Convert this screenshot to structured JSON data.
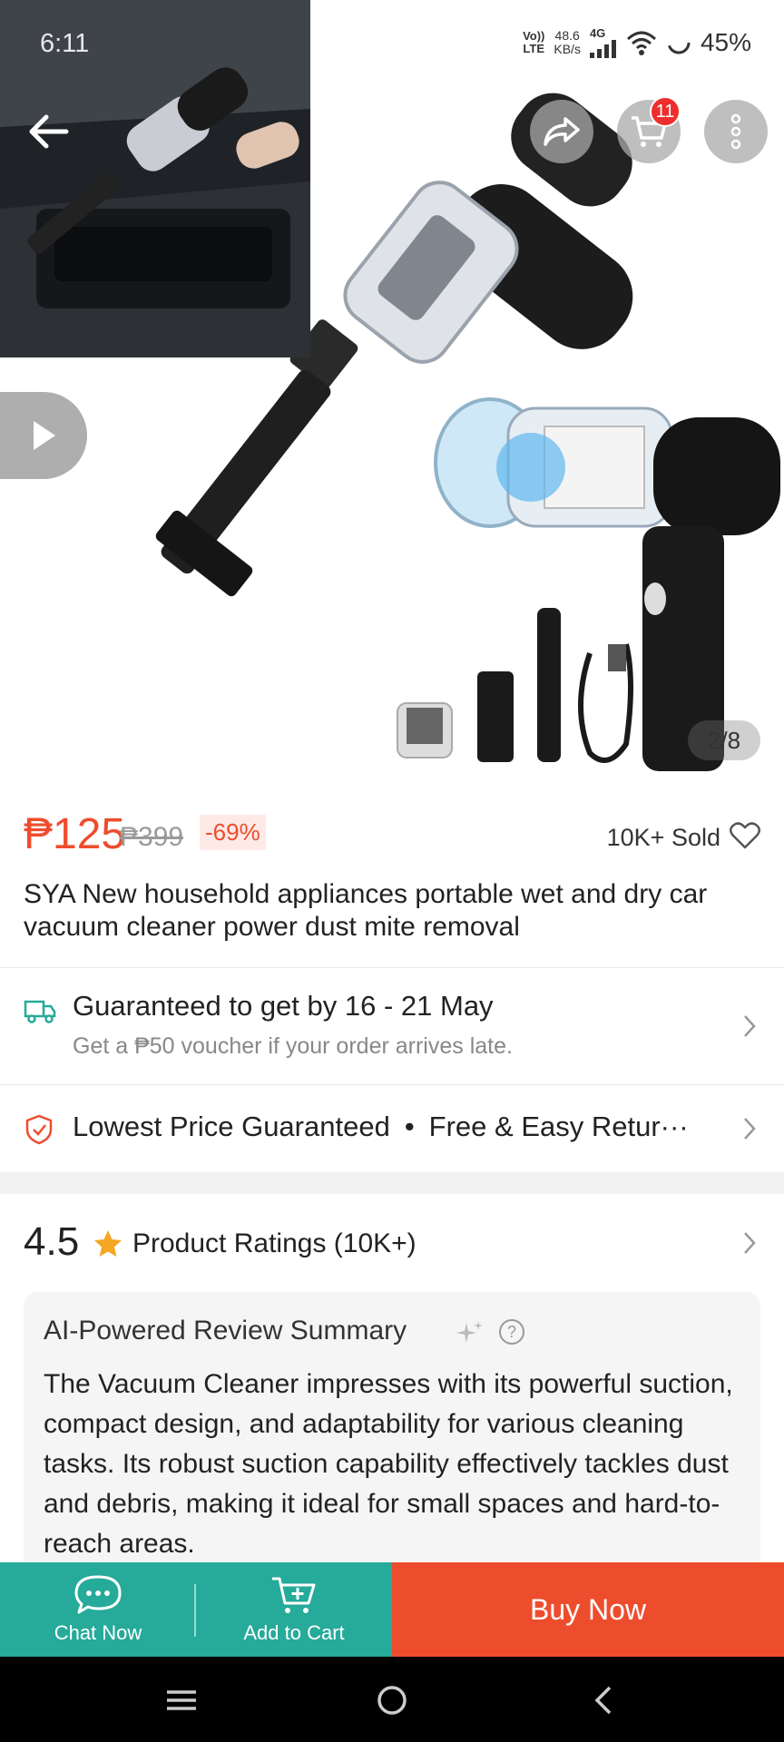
{
  "status_bar": {
    "time": "6:11",
    "network_badge_top": "Vo))",
    "network_badge_bottom": "LTE",
    "speed_value": "48.6",
    "speed_unit": "KB/s",
    "signal_type": "4G",
    "battery": "45%"
  },
  "header": {
    "cart_count": "11"
  },
  "gallery": {
    "counter": "2/8"
  },
  "product": {
    "price": "₱125",
    "original_price": "₱399",
    "discount": "-69%",
    "sold": "10K+ Sold",
    "title": "SYA New household appliances portable wet and dry car vacuum cleaner power dust mite removal"
  },
  "shipping": {
    "title": "Guaranteed to get by 16 - 21 May",
    "subtitle": "Get a ₱50 voucher if your order arrives late."
  },
  "guarantees": {
    "item1": "Lowest Price Guaranteed",
    "separator": "•",
    "item2": "Free & Easy Retur···"
  },
  "ratings": {
    "score": "4.5",
    "label": "Product Ratings (10K+)"
  },
  "ai_summary": {
    "title": "AI-Powered Review Summary",
    "help": "?",
    "body": "The Vacuum Cleaner impresses with its powerful suction, compact design, and adaptability for various cleaning tasks. Its robust suction capability effectively tackles dust and debris, making it ideal for small spaces and hard-to-reach areas."
  },
  "bottom_bar": {
    "chat_label": "Chat Now",
    "cart_label": "Add to Cart",
    "buy_label": "Buy Now"
  },
  "colors": {
    "brand_orange": "#ee4d2d",
    "teal": "#26aa99",
    "star": "#f5a623"
  }
}
